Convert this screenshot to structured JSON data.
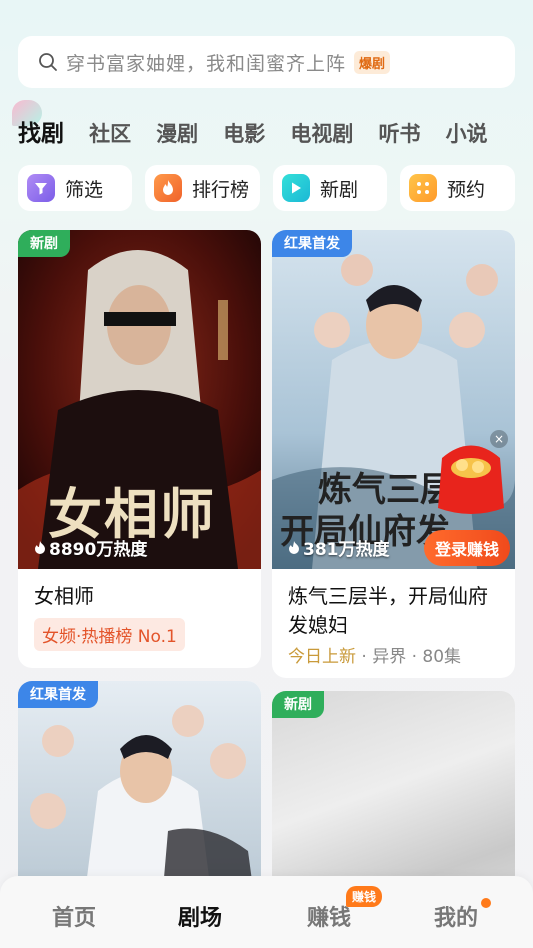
{
  "search": {
    "placeholder_text": "穿书富家妯娌，我和闺蜜齐上阵",
    "hot_tag": "爆剧"
  },
  "tabs": [
    "找剧",
    "社区",
    "漫剧",
    "电影",
    "电视剧",
    "听书",
    "小说"
  ],
  "quick": [
    {
      "label": "筛选",
      "icon": "filter-icon"
    },
    {
      "label": "排行榜",
      "icon": "flame-icon"
    },
    {
      "label": "新剧",
      "icon": "play-icon"
    },
    {
      "label": "预约",
      "icon": "grid-dots-icon"
    }
  ],
  "cards": [
    {
      "badge": "新剧",
      "heat": "8890万热度",
      "title": "女相师",
      "rank": "女频·热播榜 No.1",
      "poster_title": "女相师"
    },
    {
      "badge": "红果首发",
      "heat": "381万热度",
      "title": "炼气三层半，开局仙府发媳妇",
      "meta_highlight": "今日上新",
      "meta_rest": " · 异界 · 80集",
      "poster_title_line1": "炼气三层",
      "poster_title_line2": "开局仙府发",
      "login_button": "登录赚钱",
      "close": "×"
    },
    {
      "badge": "红果首发"
    },
    {
      "badge": "新剧"
    }
  ],
  "nav": {
    "items": [
      "首页",
      "剧场",
      "赚钱",
      "我的"
    ],
    "active": "剧场",
    "earn_badge": "赚钱"
  },
  "colors": {
    "accent_orange": "#ff7a1a",
    "badge_green": "#2fae5b",
    "badge_blue": "#3d86e8"
  }
}
